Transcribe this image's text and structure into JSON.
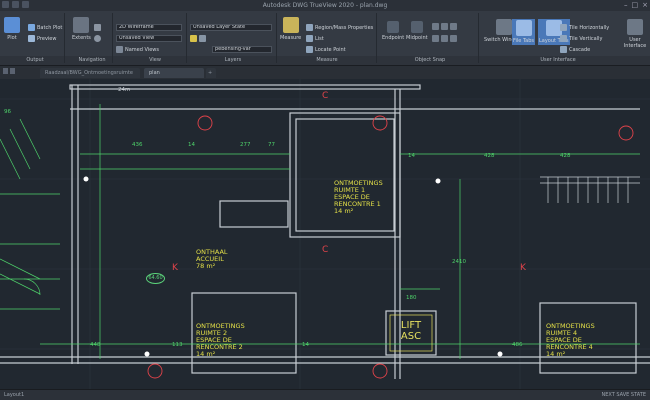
{
  "app": {
    "title": "Autodesk DWG TrueView 2020 - plan.dwg"
  },
  "ribbon": {
    "groups": [
      {
        "label": "Output"
      },
      {
        "label": "Navigation"
      },
      {
        "label": "View"
      },
      {
        "label": "Layers"
      },
      {
        "label": "Measure"
      },
      {
        "label": "Object Snap"
      },
      {
        "label": "User Interface"
      }
    ],
    "output": {
      "plot": "Plot",
      "batch_plot": "Batch Plot",
      "preview": "Preview"
    },
    "navigation": {
      "extents": "Extents",
      "pan": "Pan",
      "orbit": "Orbit"
    },
    "view": {
      "visual_style": "2D Wireframe",
      "view_dropdown": "Unsaved View",
      "named_views": "Named Views"
    },
    "layers": {
      "layer_state": "Unsaved Layer State",
      "layer_dropdown": "pebensing-var"
    },
    "measure": {
      "measure": "Measure",
      "region_props": "Region/Mass Properties",
      "list": "List",
      "locate_point": "Locate Point"
    },
    "object_snap": {
      "endpoint": "Endpoint",
      "midpoint": "Midpoint"
    },
    "user_interface": {
      "switch_windows": "Switch Windows",
      "file_tabs": "File Tabs",
      "layout_tabs": "Layout Tabs",
      "tile_horizontally": "Tile Horizontally",
      "tile_vertically": "Tile Vertically",
      "cascade": "Cascade",
      "user_interface": "User Interface"
    }
  },
  "tabs": {
    "items": [
      {
        "label": "Raadzaal/BWG_Ontmoetingsruimte"
      },
      {
        "label": "plan"
      }
    ]
  },
  "drawing": {
    "rooms": [
      {
        "line1": "ONTMOETINGS",
        "line2": "RUIMTE 1",
        "line3": "ESPACE DE",
        "line4": "RENCONTRE 1",
        "area": "14 m²"
      },
      {
        "line1": "ONTHAAL",
        "line2": "ACCUEIL",
        "area": "78 m²"
      },
      {
        "line1": "ONTMOETINGS",
        "line2": "RUIMTE 2",
        "line3": "ESPACE DE",
        "line4": "RENCONTRE 2",
        "area": "14 m²"
      },
      {
        "line1": "ONTMOETINGS",
        "line2": "RUIMTE 4",
        "line3": "ESPACE DE",
        "line4": "RENCONTRE 4",
        "area": "14 m²"
      }
    ],
    "lift": {
      "line1": "LIFT",
      "line2": "ASC"
    },
    "axes": [
      {
        "label": "C"
      },
      {
        "label": "C"
      },
      {
        "label": "K"
      },
      {
        "label": "K"
      }
    ],
    "dimensions": [
      "436",
      "14",
      "277",
      "77",
      "428",
      "14",
      "428",
      "180",
      "113",
      "486",
      "448",
      "14",
      "2410",
      "96"
    ],
    "tag": "64.60",
    "top_mark": "24m"
  },
  "status": {
    "left": "Layout1",
    "right": "NEXT SAVE STATE"
  },
  "colors": {
    "wall": "#c7cdd3",
    "dimension": "#4ed36a",
    "room_text": "#e4e048",
    "axis": "#e0434a",
    "background": "#212830"
  }
}
